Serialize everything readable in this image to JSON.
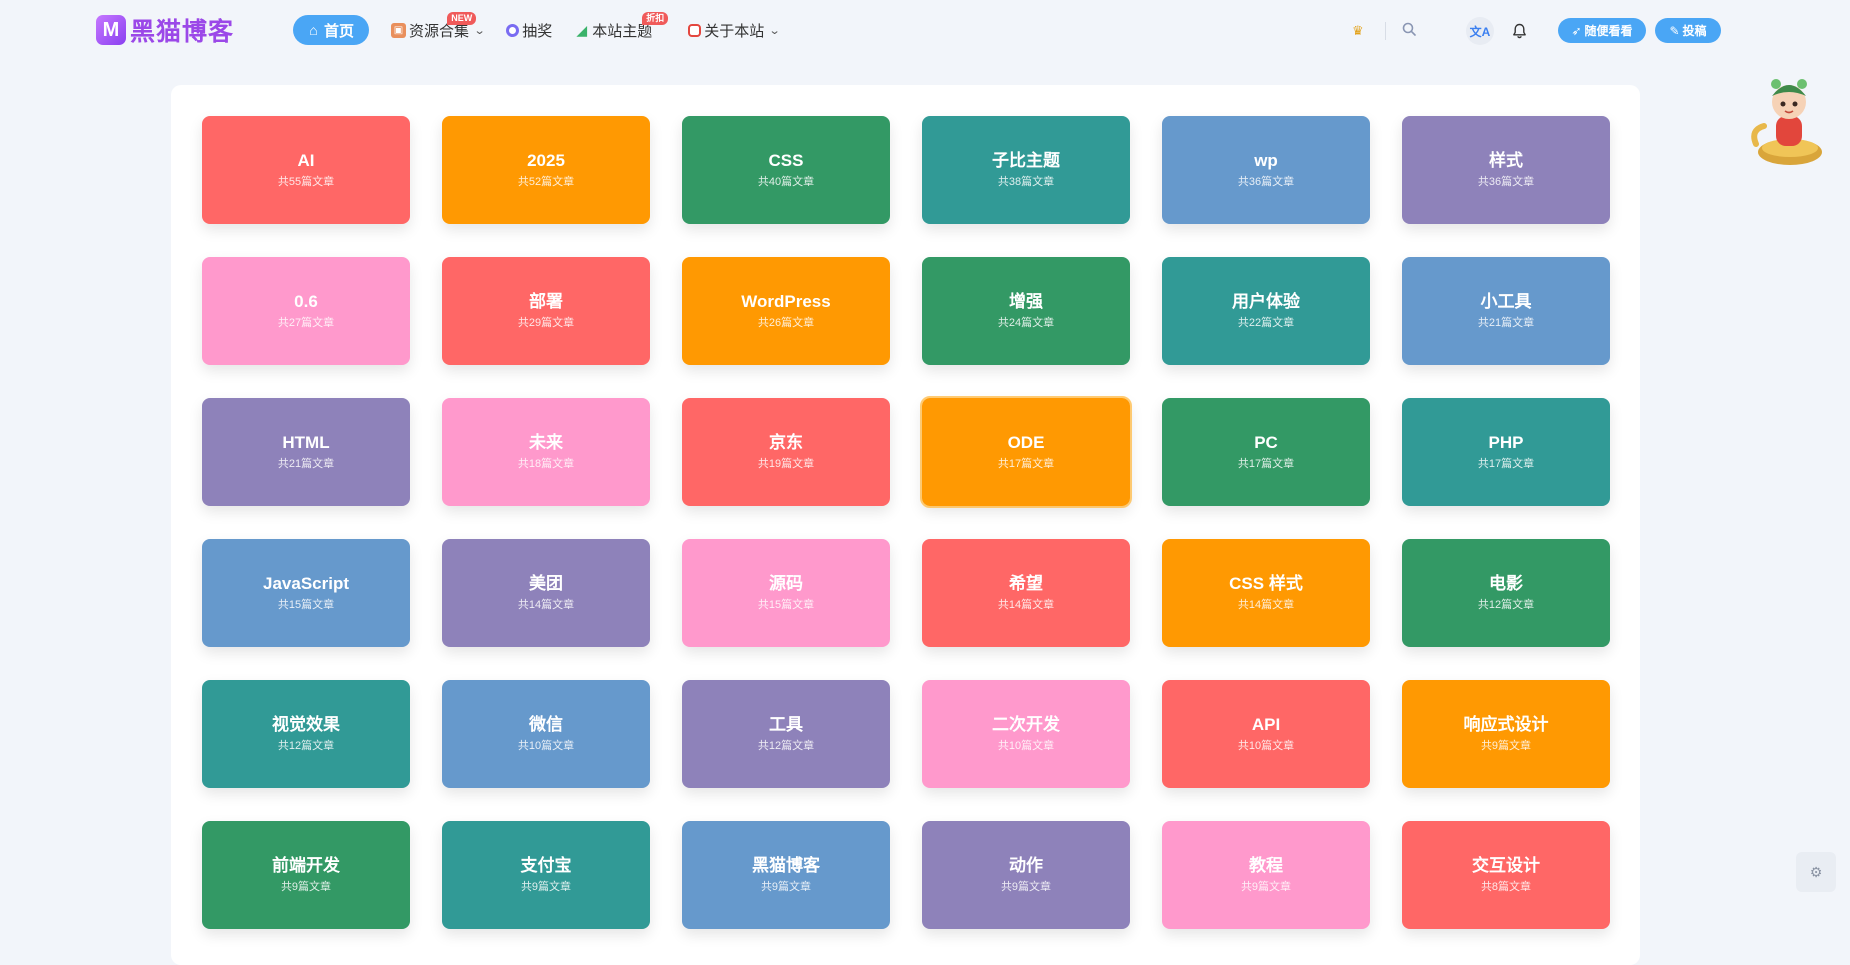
{
  "header": {
    "logo_text": "黑猫博客",
    "logo_mark": "M",
    "nav": [
      {
        "label": "首页",
        "icon": "home-icon",
        "active": true
      },
      {
        "label": "资源合集",
        "icon": "gift-icon",
        "badge": "NEW",
        "dropdown": true
      },
      {
        "label": "抽奖",
        "icon": "lottery-icon"
      },
      {
        "label": "本站主题",
        "icon": "theme-icon",
        "badge": "折扣"
      },
      {
        "label": "关于本站",
        "icon": "about-icon",
        "dropdown": true
      }
    ],
    "random_button": "随便看看",
    "submit_button": "投稿",
    "translate_glyph": "文A"
  },
  "tags": [
    {
      "name": "AI",
      "count": "共55篇文章",
      "color": "#ff6766"
    },
    {
      "name": "2025",
      "count": "共52篇文章",
      "color": "#ff9902"
    },
    {
      "name": "CSS",
      "count": "共40篇文章",
      "color": "#339965"
    },
    {
      "name": "子比主题",
      "count": "共38篇文章",
      "color": "#319a96"
    },
    {
      "name": "wp",
      "count": "共36篇文章",
      "color": "#6699cc"
    },
    {
      "name": "样式",
      "count": "共36篇文章",
      "color": "#8e82ba"
    },
    {
      "name": "0.6",
      "count": "共27篇文章",
      "color": "#ff99cc"
    },
    {
      "name": "部署",
      "count": "共29篇文章",
      "color": "#ff6766"
    },
    {
      "name": "WordPress",
      "count": "共26篇文章",
      "color": "#ff9902"
    },
    {
      "name": "增强",
      "count": "共24篇文章",
      "color": "#339965"
    },
    {
      "name": "用户体验",
      "count": "共22篇文章",
      "color": "#319a96"
    },
    {
      "name": "小工具",
      "count": "共21篇文章",
      "color": "#6699cc"
    },
    {
      "name": "HTML",
      "count": "共21篇文章",
      "color": "#8e82ba"
    },
    {
      "name": "未来",
      "count": "共18篇文章",
      "color": "#ff99cc"
    },
    {
      "name": "京东",
      "count": "共19篇文章",
      "color": "#ff6766"
    },
    {
      "name": "ODE",
      "count": "共17篇文章",
      "color": "#ff9902"
    },
    {
      "name": "PC",
      "count": "共17篇文章",
      "color": "#339965"
    },
    {
      "name": "PHP",
      "count": "共17篇文章",
      "color": "#319a96"
    },
    {
      "name": "JavaScript",
      "count": "共15篇文章",
      "color": "#6699cc"
    },
    {
      "name": "美团",
      "count": "共14篇文章",
      "color": "#8e82ba"
    },
    {
      "name": "源码",
      "count": "共15篇文章",
      "color": "#ff99cc"
    },
    {
      "name": "希望",
      "count": "共14篇文章",
      "color": "#ff6766"
    },
    {
      "name": "CSS 样式",
      "count": "共14篇文章",
      "color": "#ff9902"
    },
    {
      "name": "电影",
      "count": "共12篇文章",
      "color": "#339965"
    },
    {
      "name": "视觉效果",
      "count": "共12篇文章",
      "color": "#319a96"
    },
    {
      "name": "微信",
      "count": "共10篇文章",
      "color": "#6699cc"
    },
    {
      "name": "工具",
      "count": "共12篇文章",
      "color": "#8e82ba"
    },
    {
      "name": "二次开发",
      "count": "共10篇文章",
      "color": "#ff99cc"
    },
    {
      "name": "API",
      "count": "共10篇文章",
      "color": "#ff6766"
    },
    {
      "name": "响应式设计",
      "count": "共9篇文章",
      "color": "#ff9902"
    },
    {
      "name": "前端开发",
      "count": "共9篇文章",
      "color": "#339965"
    },
    {
      "name": "支付宝",
      "count": "共9篇文章",
      "color": "#319a96"
    },
    {
      "name": "黑猫博客",
      "count": "共9篇文章",
      "color": "#6699cc"
    },
    {
      "name": "动作",
      "count": "共9篇文章",
      "color": "#8e82ba"
    },
    {
      "name": "教程",
      "count": "共9篇文章",
      "color": "#ff99cc"
    },
    {
      "name": "交互设计",
      "count": "共8篇文章",
      "color": "#ff6766"
    }
  ]
}
